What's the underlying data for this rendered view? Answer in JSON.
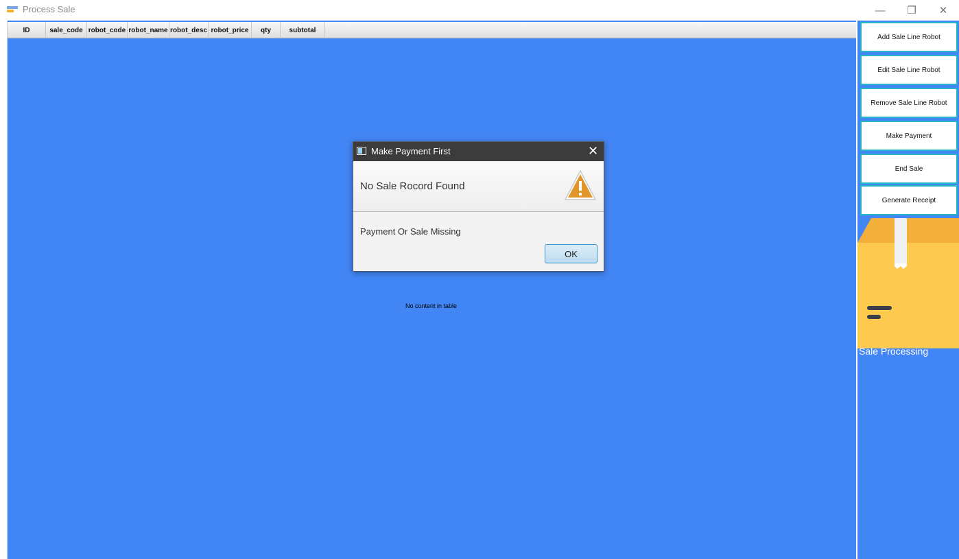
{
  "window": {
    "title": "Process Sale",
    "minimize_glyph": "—",
    "maximize_glyph": "❐",
    "close_glyph": "✕"
  },
  "table": {
    "columns": [
      "ID",
      "sale_code",
      "robot_code",
      "robot_name",
      "robot_desc",
      "robot_price",
      "qty",
      "subtotal"
    ],
    "empty_message": "No content in table"
  },
  "sidebar": {
    "buttons": [
      "Add Sale Line Robot",
      "Edit Sale Line Robot",
      "Remove Sale Line Robot",
      "Make Payment",
      "End Sale",
      "Generate Receipt"
    ],
    "label": "Sale Processing"
  },
  "dialog": {
    "title": "Make Payment First",
    "close_glyph": "✕",
    "header": "No Sale Rocord Found",
    "content": "Payment Or Sale Missing",
    "ok_label": "OK"
  },
  "colors": {
    "background_blue": "#4285f4",
    "button_border": "#26b6c6",
    "warning_orange": "#e0962a",
    "box_yellow": "#fdc94f"
  }
}
